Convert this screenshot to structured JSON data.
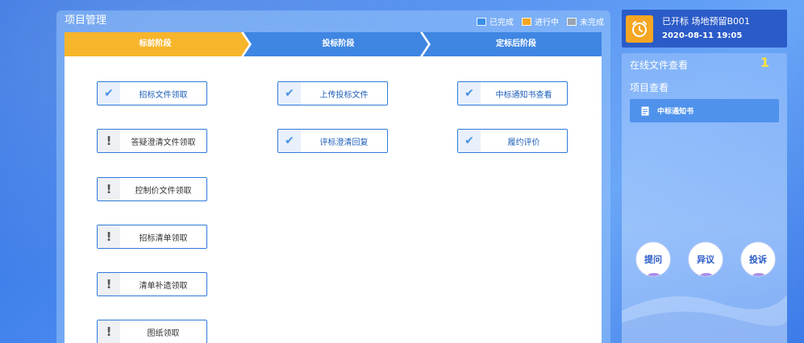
{
  "panel": {
    "title": "项目管理",
    "legend": [
      {
        "label": "已完成",
        "color": "#3a8ee6"
      },
      {
        "label": "进行中",
        "color": "#f6a623"
      },
      {
        "label": "未完成",
        "color": "#9aa5b1"
      }
    ]
  },
  "stages": [
    {
      "label": "标前阶段",
      "status": "in-progress",
      "color": "#f7b52b"
    },
    {
      "label": "投标阶段",
      "status": "completed",
      "color": "#3f86e3"
    },
    {
      "label": "定标后阶段",
      "status": "completed",
      "color": "#3f86e3"
    }
  ],
  "tasks": {
    "col1": [
      {
        "label": "招标文件领取",
        "status": "done"
      },
      {
        "label": "答疑澄清文件领取",
        "status": "pending"
      },
      {
        "label": "控制价文件领取",
        "status": "pending"
      },
      {
        "label": "招标清单领取",
        "status": "pending"
      },
      {
        "label": "清单补遗领取",
        "status": "pending"
      },
      {
        "label": "图纸领取",
        "status": "pending"
      }
    ],
    "col2": [
      {
        "label": "上传投标文件",
        "status": "done"
      },
      {
        "label": "评标澄清回复",
        "status": "done"
      }
    ],
    "col3": [
      {
        "label": "中标通知书查看",
        "status": "done"
      },
      {
        "label": "履约评价",
        "status": "done"
      }
    ]
  },
  "notice": {
    "title": "已开标 场地预留B001",
    "datetime": "2020-08-11 19:05"
  },
  "side": {
    "online_label": "在线文件查看",
    "online_count": "1",
    "project_label": "项目查看",
    "doc_label": "中标通知书",
    "actions": [
      "提问",
      "异议",
      "投诉"
    ]
  }
}
